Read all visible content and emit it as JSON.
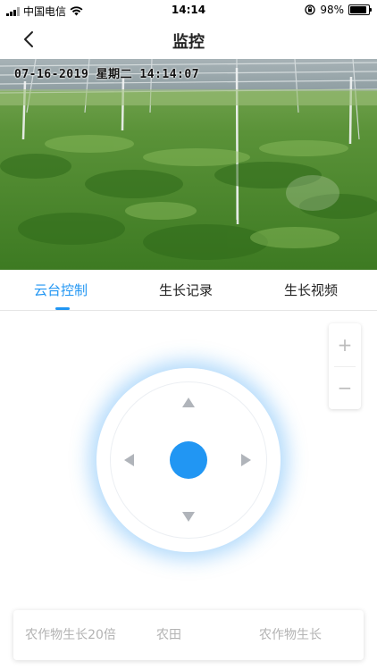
{
  "status_bar": {
    "carrier": "中国电信",
    "time": "14:14",
    "battery": "98%",
    "battery_level": 0.98,
    "icons": [
      "signal-icon",
      "wifi-icon",
      "orientation-lock-icon",
      "battery-icon"
    ]
  },
  "nav": {
    "title": "监控",
    "back_icon": "chevron-left-icon"
  },
  "video": {
    "timestamp": "07-16-2019 星期二 14:14:07"
  },
  "tabs": [
    {
      "label": "云台控制",
      "active": true
    },
    {
      "label": "生长记录",
      "active": false
    },
    {
      "label": "生长视频",
      "active": false
    }
  ],
  "zoom": {
    "in_label": "+",
    "out_label": "−"
  },
  "joystick": {
    "directions": [
      "up-arrow-icon",
      "down-arrow-icon",
      "left-arrow-icon",
      "right-arrow-icon"
    ]
  },
  "presets": [
    {
      "label": "农作物生长20倍"
    },
    {
      "label": "农田"
    },
    {
      "label": "农作物生长"
    }
  ],
  "colors": {
    "accent": "#2196f3",
    "muted": "#b3b3b3",
    "glow": "#2196f3"
  }
}
